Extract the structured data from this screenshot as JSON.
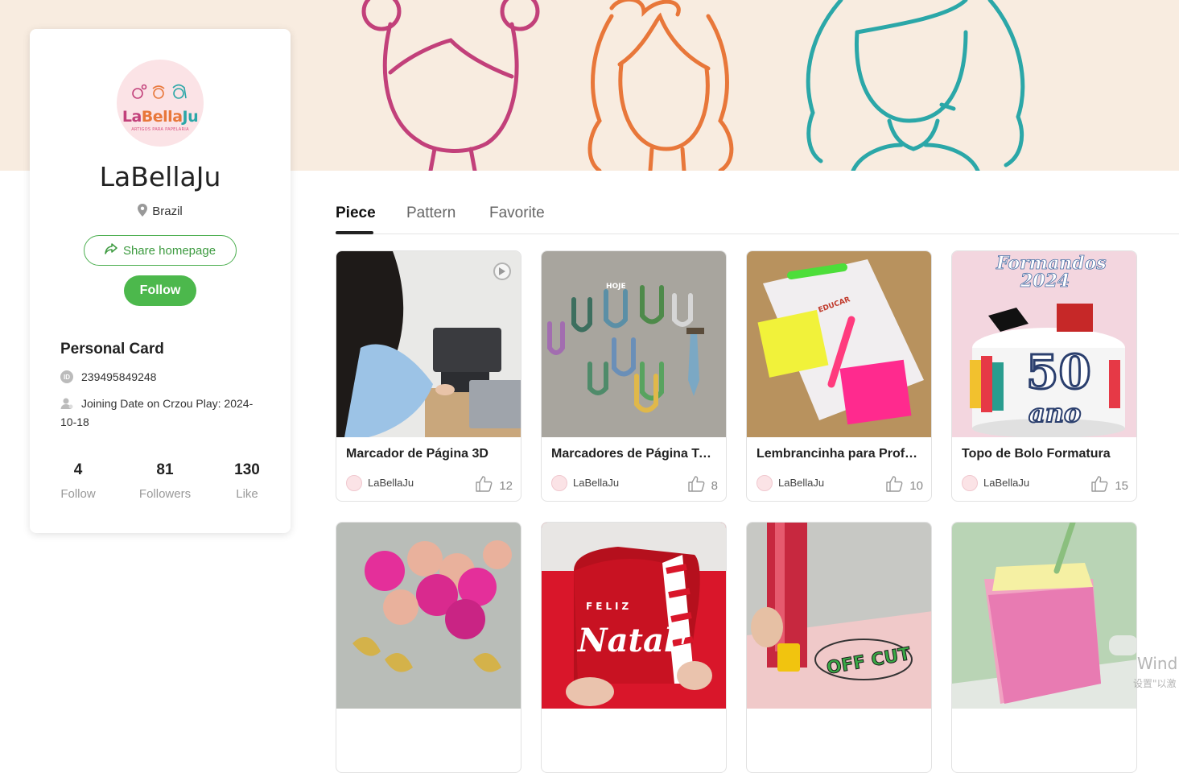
{
  "profile": {
    "avatar_logo": "LaBellaJu",
    "avatar_subtitle": "ARTIGOS PARA PAPELARIA",
    "name": "LaBellaJu",
    "location": "Brazil",
    "share_label": "Share homepage",
    "follow_label": "Follow",
    "card_title": "Personal Card",
    "id_badge": "ID",
    "user_id": "239495849248",
    "join_date": "Joining Date on Crzou Play: 2024-10-18",
    "stats": [
      {
        "value": "4",
        "label": "Follow"
      },
      {
        "value": "81",
        "label": "Followers"
      },
      {
        "value": "130",
        "label": "Like"
      }
    ]
  },
  "tabs": [
    {
      "label": "Piece",
      "active": true
    },
    {
      "label": "Pattern",
      "active": false
    },
    {
      "label": "Favorite",
      "active": false
    }
  ],
  "pieces": [
    {
      "title": "Marcador de Página 3D",
      "author": "LaBellaJu",
      "likes": "12",
      "video": true
    },
    {
      "title": "Marcadores de Página Temáticos",
      "author": "LaBellaJu",
      "likes": "8",
      "video": false
    },
    {
      "title": "Lembrancinha para Professores",
      "author": "LaBellaJu",
      "likes": "10",
      "video": false
    },
    {
      "title": "Topo de Bolo Formatura",
      "author": "LaBellaJu",
      "likes": "15",
      "video": false
    },
    {
      "title": "",
      "author": "",
      "likes": "",
      "video": false
    },
    {
      "title": "",
      "author": "",
      "likes": "",
      "video": false
    },
    {
      "title": "",
      "author": "",
      "likes": "",
      "video": false
    },
    {
      "title": "",
      "author": "",
      "likes": "",
      "video": false
    }
  ],
  "image_text": {
    "cake_line1": "Formandos",
    "cake_line2": "2024",
    "cake_number": "50",
    "cake_word": "ano",
    "natal_top": "FELIZ",
    "natal_word": "Natal!",
    "bookmark_word": "HOJE",
    "educar": "EDUCAR",
    "offcut": "OFF CUT"
  },
  "watermark": {
    "line1": "Wind",
    "line2": "设置\"以激"
  },
  "colors": {
    "accent_green": "#4cb84c",
    "banner_bg": "#f8ece0",
    "face_magenta": "#c2407a",
    "face_orange": "#e8773a",
    "face_teal": "#2ba7a8"
  }
}
